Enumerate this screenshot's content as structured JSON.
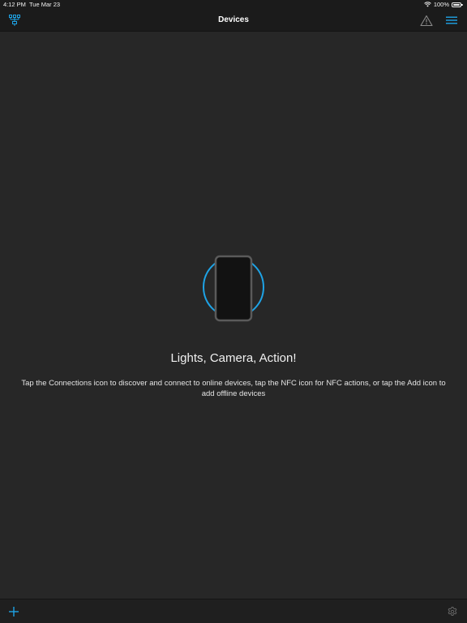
{
  "status_bar": {
    "time": "4:12 PM",
    "date": "Tue Mar 23",
    "battery": "100%",
    "wifi_icon": "wifi-icon",
    "battery_icon": "battery-icon",
    "battery_level": 1.0
  },
  "nav_bar": {
    "title": "Devices",
    "left_icon": "connections-icon",
    "warning_icon": "warning-icon",
    "menu_icon": "menu-icon"
  },
  "empty_state": {
    "illustration": "phone-icon",
    "title": "Lights, Camera, Action!",
    "message": "Tap the Connections icon to discover and connect to online devices, tap the NFC icon for NFC actions, or tap the Add icon to add offline devices"
  },
  "bottom_bar": {
    "add_icon": "plus-icon",
    "settings_icon": "gear-icon"
  },
  "colors": {
    "accent": "#1ea3e6",
    "background": "#272727",
    "bar_background": "#1b1b1b",
    "icon_gray": "#8a8a8a"
  }
}
